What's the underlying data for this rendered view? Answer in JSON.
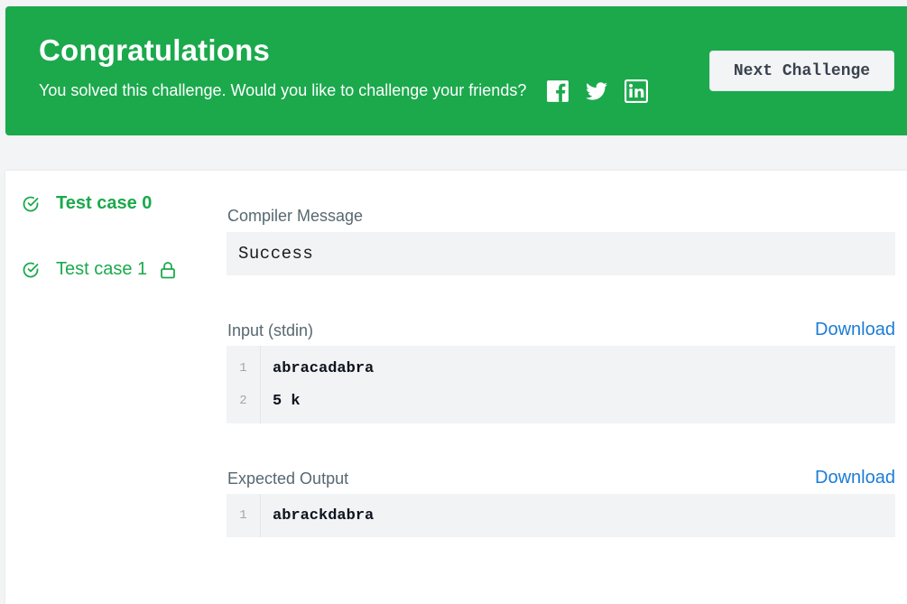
{
  "banner": {
    "title": "Congratulations",
    "subtitle": "You solved this challenge. Would you like to challenge your friends?",
    "share_icons": [
      "facebook-icon",
      "twitter-icon",
      "linkedin-icon"
    ],
    "next_button_label": "Next Challenge",
    "color": "#1ba94c"
  },
  "test_cases": [
    {
      "label": "Test case 0",
      "status": "passed",
      "active": true,
      "locked": false
    },
    {
      "label": "Test case 1",
      "status": "passed",
      "active": false,
      "locked": true
    }
  ],
  "compiler": {
    "label": "Compiler Message",
    "message": "Success"
  },
  "input": {
    "label": "Input (stdin)",
    "download_label": "Download",
    "lines": [
      {
        "num": "1",
        "text": "abracadabra"
      },
      {
        "num": "2",
        "text": "5 k"
      }
    ]
  },
  "expected": {
    "label": "Expected Output",
    "download_label": "Download",
    "lines": [
      {
        "num": "1",
        "text": "abrackdabra"
      }
    ]
  }
}
